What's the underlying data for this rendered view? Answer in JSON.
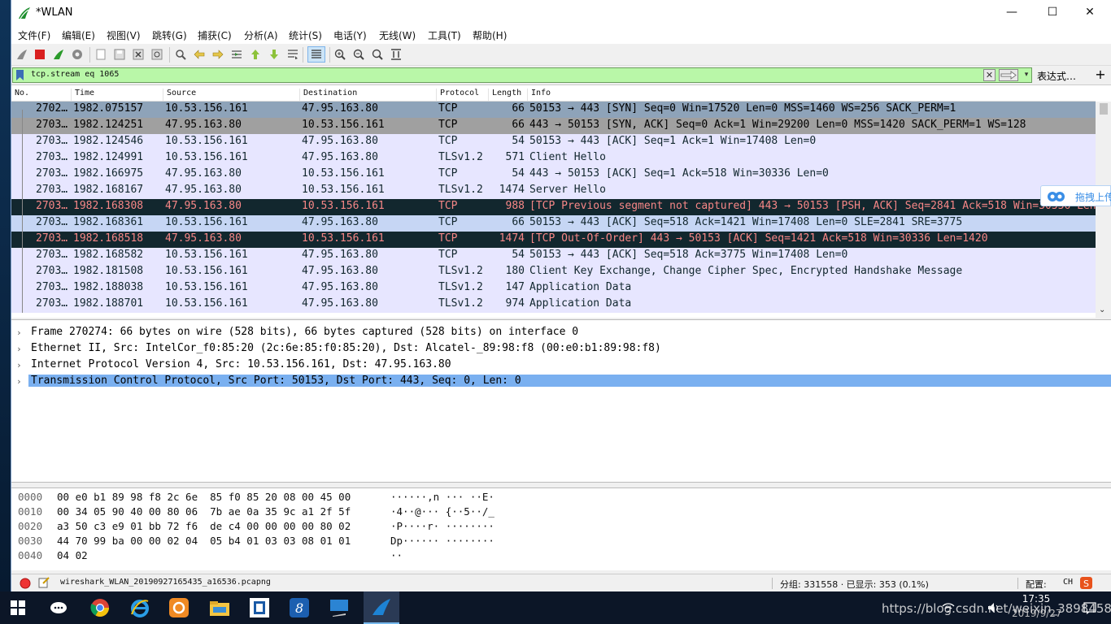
{
  "window": {
    "title": "*WLAN",
    "minimize": "—",
    "maximize": "☐",
    "close": "✕"
  },
  "menu": [
    "文件(F)",
    "编辑(E)",
    "视图(V)",
    "跳转(G)",
    "捕获(C)",
    "分析(A)",
    "统计(S)",
    "电话(Y)",
    "无线(W)",
    "工具(T)",
    "帮助(H)"
  ],
  "toolbar_icons": [
    "shark-fin-icon",
    "stop-icon",
    "restart-icon",
    "options-icon",
    "open-icon",
    "save-icon",
    "close-file-icon",
    "reload-icon",
    "find-icon",
    "back-icon",
    "forward-icon",
    "goto-icon",
    "first-icon",
    "last-icon",
    "autoscroll-icon",
    "colorize-icon",
    "zoom-in-icon",
    "zoom-out-icon",
    "zoom-reset-icon",
    "resize-columns-icon"
  ],
  "filter": {
    "text": "tcp.stream eq 1065",
    "expression_label": "表达式…",
    "plus": "+",
    "clear": "✕",
    "dropdown": "▾"
  },
  "columns": [
    "No.",
    "Time",
    "Source",
    "Destination",
    "Protocol",
    "Length",
    "Info"
  ],
  "packets": [
    {
      "no": "2702…",
      "time": "1982.075157",
      "src": "10.53.156.161",
      "dst": "47.95.163.80",
      "proto": "TCP",
      "len": "66",
      "info": "50153 → 443 [SYN] Seq=0 Win=17520 Len=0 MSS=1460 WS=256 SACK_PERM=1",
      "style": "sel-grey"
    },
    {
      "no": "2703…",
      "time": "1982.124251",
      "src": "47.95.163.80",
      "dst": "10.53.156.161",
      "proto": "TCP",
      "len": "66",
      "info": "443 → 50153 [SYN, ACK] Seq=0 Ack=1 Win=29200 Len=0 MSS=1420 SACK_PERM=1 WS=128",
      "style": "grey"
    },
    {
      "no": "2703…",
      "time": "1982.124546",
      "src": "10.53.156.161",
      "dst": "47.95.163.80",
      "proto": "TCP",
      "len": "54",
      "info": "50153 → 443 [ACK] Seq=1 Ack=1 Win=17408 Len=0",
      "style": "lav"
    },
    {
      "no": "2703…",
      "time": "1982.124991",
      "src": "10.53.156.161",
      "dst": "47.95.163.80",
      "proto": "TLSv1.2",
      "len": "571",
      "info": "Client Hello",
      "style": "lav"
    },
    {
      "no": "2703…",
      "time": "1982.166975",
      "src": "47.95.163.80",
      "dst": "10.53.156.161",
      "proto": "TCP",
      "len": "54",
      "info": "443 → 50153 [ACK] Seq=1 Ack=518 Win=30336 Len=0",
      "style": "lav"
    },
    {
      "no": "2703…",
      "time": "1982.168167",
      "src": "47.95.163.80",
      "dst": "10.53.156.161",
      "proto": "TLSv1.2",
      "len": "1474",
      "info": "Server Hello",
      "style": "lav"
    },
    {
      "no": "2703…",
      "time": "1982.168308",
      "src": "47.95.163.80",
      "dst": "10.53.156.161",
      "proto": "TCP",
      "len": "988",
      "info": "[TCP Previous segment not captured] 443 → 50153 [PSH, ACK] Seq=2841 Ack=518 Win=30336 Len=934",
      "style": "bad"
    },
    {
      "no": "2703…",
      "time": "1982.168361",
      "src": "10.53.156.161",
      "dst": "47.95.163.80",
      "proto": "TCP",
      "len": "66",
      "info": "50153 → 443 [ACK] Seq=518 Ack=1421 Win=17408 Len=0 SLE=2841 SRE=3775",
      "style": "sack"
    },
    {
      "no": "2703…",
      "time": "1982.168518",
      "src": "47.95.163.80",
      "dst": "10.53.156.161",
      "proto": "TCP",
      "len": "1474",
      "info": "[TCP Out-Of-Order] 443 → 50153 [ACK] Seq=1421 Ack=518 Win=30336 Len=1420",
      "style": "bad"
    },
    {
      "no": "2703…",
      "time": "1982.168582",
      "src": "10.53.156.161",
      "dst": "47.95.163.80",
      "proto": "TCP",
      "len": "54",
      "info": "50153 → 443 [ACK] Seq=518 Ack=3775 Win=17408 Len=0",
      "style": "lav"
    },
    {
      "no": "2703…",
      "time": "1982.181508",
      "src": "10.53.156.161",
      "dst": "47.95.163.80",
      "proto": "TLSv1.2",
      "len": "180",
      "info": "Client Key Exchange, Change Cipher Spec, Encrypted Handshake Message",
      "style": "lav"
    },
    {
      "no": "2703…",
      "time": "1982.188038",
      "src": "10.53.156.161",
      "dst": "47.95.163.80",
      "proto": "TLSv1.2",
      "len": "147",
      "info": "Application Data",
      "style": "lav"
    },
    {
      "no": "2703…",
      "time": "1982.188701",
      "src": "10.53.156.161",
      "dst": "47.95.163.80",
      "proto": "TLSv1.2",
      "len": "974",
      "info": "Application Data",
      "style": "lav"
    }
  ],
  "row_colors": {
    "sel-grey": [
      "#8ea3b9",
      "#000"
    ],
    "grey": [
      "#a0a0a0",
      "#000"
    ],
    "lav": [
      "#e7e6ff",
      "#12272e"
    ],
    "sack": [
      "#c6d6f4",
      "#12272e"
    ],
    "bad": [
      "#12272e",
      "#f78787"
    ]
  },
  "details": [
    "Frame 270274: 66 bytes on wire (528 bits), 66 bytes captured (528 bits) on interface 0",
    "Ethernet II, Src: IntelCor_f0:85:20 (2c:6e:85:f0:85:20), Dst: Alcatel-_89:98:f8 (00:e0:b1:89:98:f8)",
    "Internet Protocol Version 4, Src: 10.53.156.161, Dst: 47.95.163.80",
    "Transmission Control Protocol, Src Port: 50153, Dst Port: 443, Seq: 0, Len: 0"
  ],
  "detail_chevron": "›",
  "bytes": [
    {
      "off": "0000",
      "hex": "00 e0 b1 89 98 f8 2c 6e  85 f0 85 20 08 00 45 00",
      "ascii": "······,n ··· ··E·"
    },
    {
      "off": "0010",
      "hex": "00 34 05 90 40 00 80 06  7b ae 0a 35 9c a1 2f 5f",
      "ascii": "·4··@··· {··5··/_"
    },
    {
      "off": "0020",
      "hex": "a3 50 c3 e9 01 bb 72 f6  de c4 00 00 00 00 80 02",
      "ascii": "·P····r· ········"
    },
    {
      "off": "0030",
      "hex": "44 70 99 ba 00 00 02 04  05 b4 01 03 03 08 01 01",
      "ascii": "Dp······ ········"
    },
    {
      "off": "0040",
      "hex": "04 02",
      "ascii": "··"
    }
  ],
  "status": {
    "file": "wireshark_WLAN_20190927165435_a16536.pcapng",
    "packets": "分组: 331558 · 已显示: 353 (0.1%)",
    "profile": "配置:",
    "lang": "CH"
  },
  "side_widget": {
    "label": "拖拽上传"
  },
  "taskbar": {
    "time": "17:35",
    "date": "2019/9/27",
    "watermark": "https://blog.csdn.net/weixin_38984580"
  }
}
